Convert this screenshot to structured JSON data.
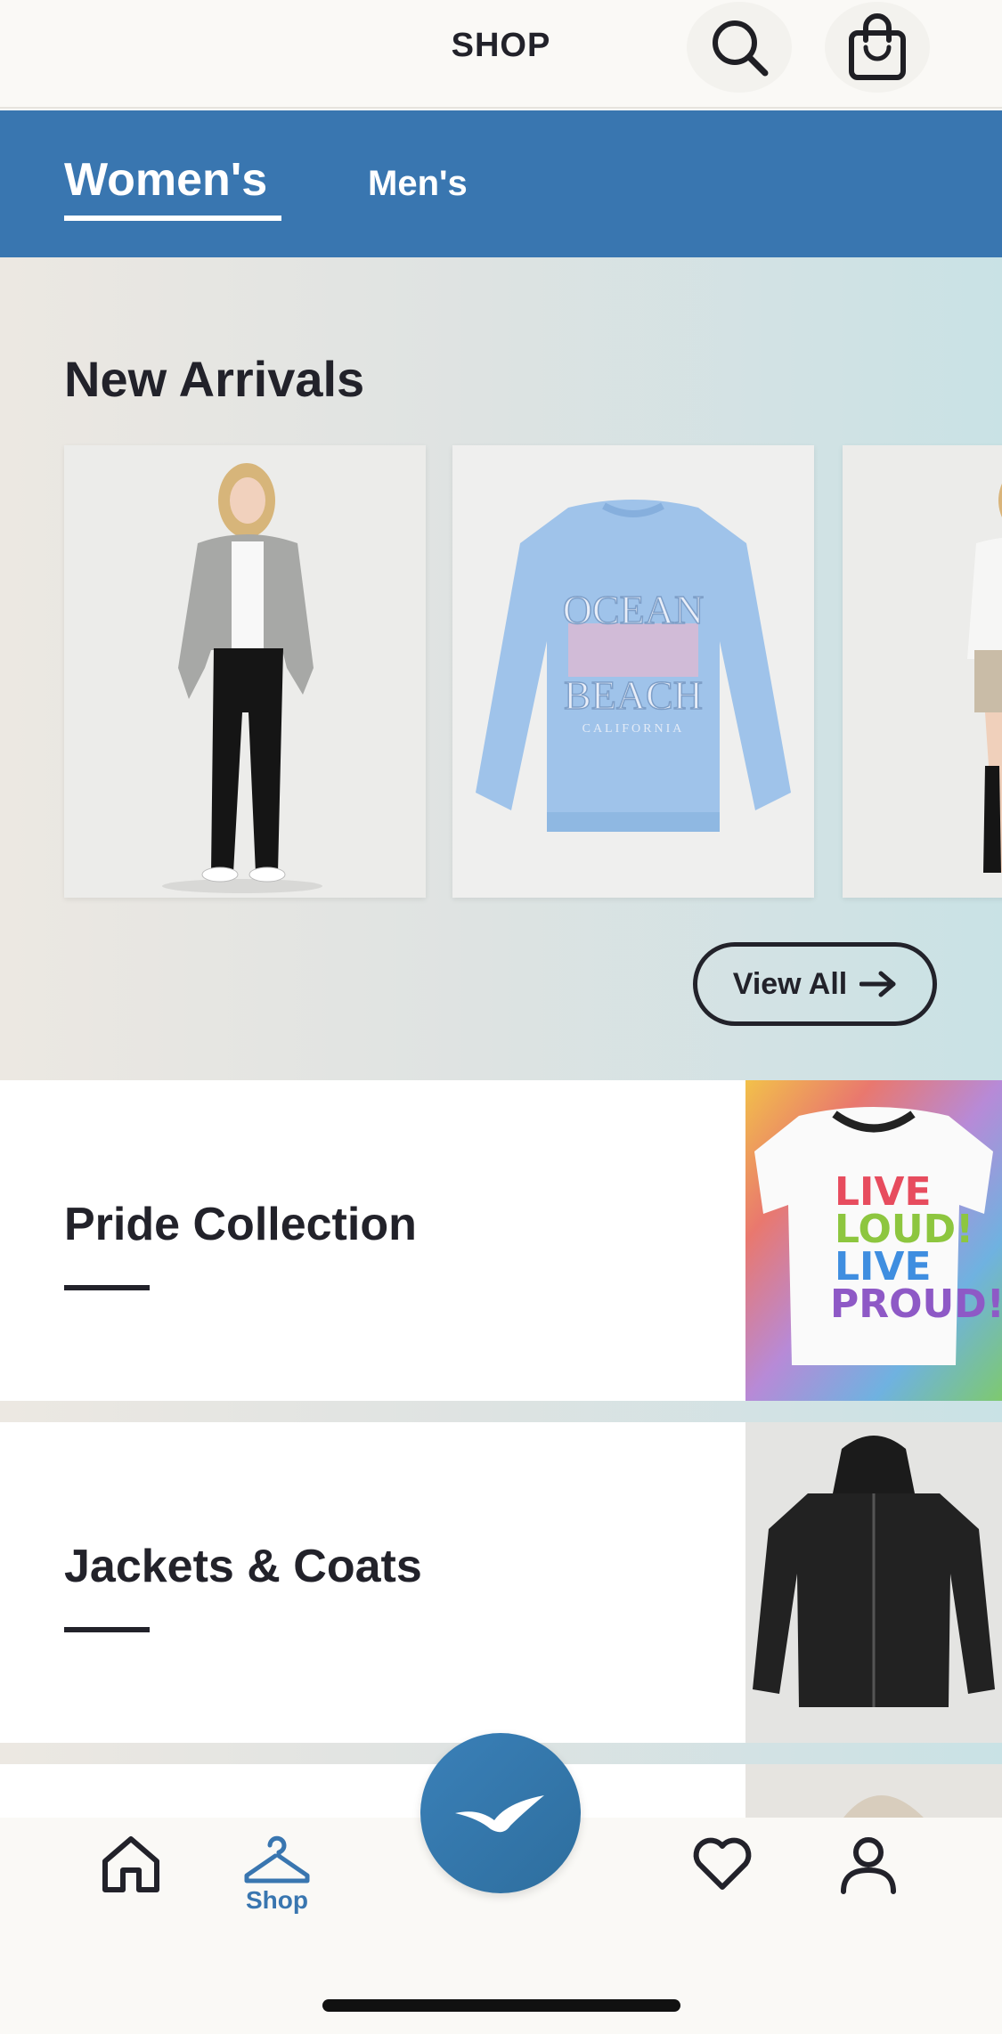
{
  "header": {
    "title": "SHOP",
    "search_icon": "search-icon",
    "bag_icon": "shopping-bag-icon"
  },
  "tabs": [
    {
      "label": "Women's",
      "selected": true
    },
    {
      "label": "Men's",
      "selected": false
    }
  ],
  "new_arrivals": {
    "heading": "New Arrivals",
    "products": [
      {
        "name": "grey-zip-hoodie-product"
      },
      {
        "name": "ocean-beach-sweatshirt-product",
        "graphic_text": [
          "OCEAN",
          "BEACH",
          "CALIFORNIA"
        ]
      },
      {
        "name": "partial-product"
      }
    ],
    "view_all_label": "View All"
  },
  "categories": [
    {
      "label": "Pride Collection",
      "graphic_text": [
        "LIVE",
        "LOUD!",
        "LIVE",
        "PROUD!"
      ]
    },
    {
      "label": "Jackets & Coats"
    }
  ],
  "bottom_nav": {
    "items": [
      {
        "icon": "home-icon",
        "label": ""
      },
      {
        "icon": "hanger-icon",
        "label": "Shop",
        "active": true
      },
      {
        "icon": "seagull-logo-icon",
        "label": ""
      },
      {
        "icon": "heart-icon",
        "label": ""
      },
      {
        "icon": "account-icon",
        "label": ""
      }
    ]
  },
  "colors": {
    "brand_blue": "#3976b0",
    "text_dark": "#22222a",
    "background": "#faf9f6"
  }
}
